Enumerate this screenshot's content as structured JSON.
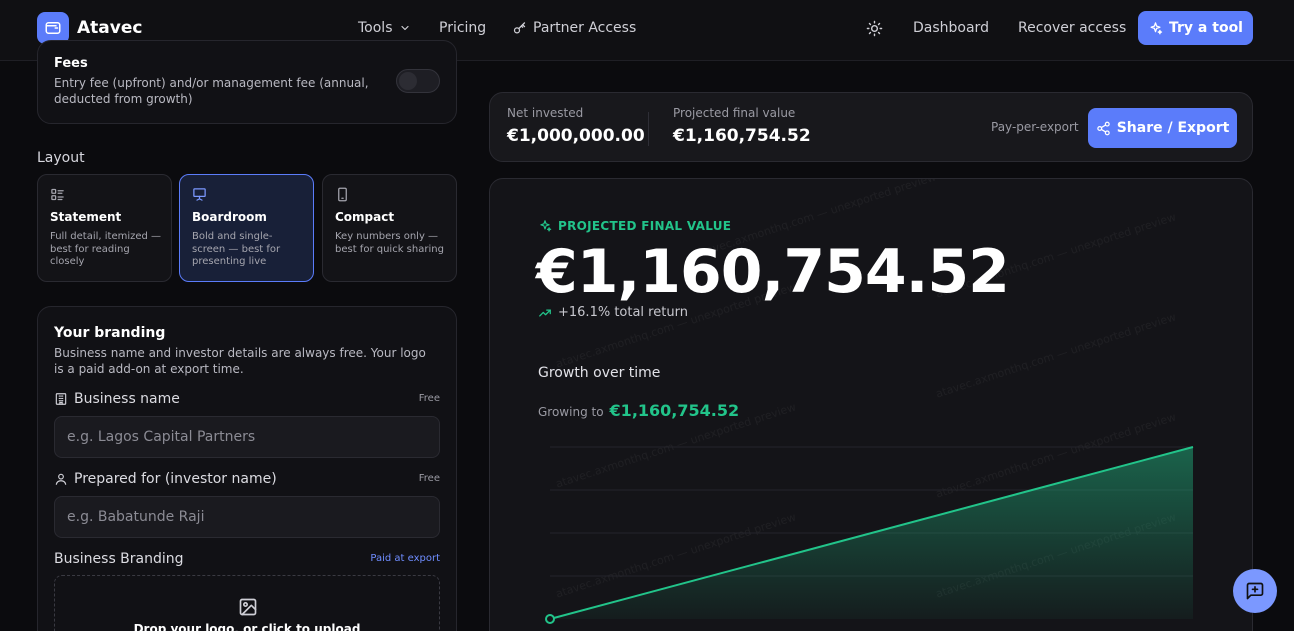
{
  "header": {
    "brand": "Atavec",
    "nav": {
      "tools": "Tools",
      "pricing": "Pricing",
      "partner_access": "Partner Access"
    },
    "dashboard": "Dashboard",
    "recover_access": "Recover access",
    "try_tool": "Try a tool"
  },
  "fees": {
    "title": "Fees",
    "description": "Entry fee (upfront) and/or management fee (annual, deducted from growth)",
    "enabled": false
  },
  "layout": {
    "label": "Layout",
    "selected": "Boardroom",
    "options": [
      {
        "title": "Statement",
        "description": "Full detail, itemized — best for reading closely",
        "icon": "list-icon"
      },
      {
        "title": "Boardroom",
        "description": "Bold and single-screen — best for presenting live",
        "icon": "presentation-icon"
      },
      {
        "title": "Compact",
        "description": "Key numbers only — best for quick sharing",
        "icon": "phone-icon"
      }
    ]
  },
  "branding": {
    "title": "Your branding",
    "description": "Business name and investor details are always free. Your logo is a paid add-on at export time.",
    "business_name": {
      "label": "Business name",
      "tag": "Free",
      "placeholder": "e.g. Lagos Capital Partners",
      "value": ""
    },
    "prepared_for": {
      "label": "Prepared for (investor name)",
      "tag": "Free",
      "placeholder": "e.g. Babatunde Raji",
      "value": ""
    },
    "business_branding": {
      "label": "Business Branding",
      "tag": "Paid at export",
      "dropzone": "Drop your logo, or click to upload"
    }
  },
  "summary": {
    "net_invested_label": "Net invested",
    "net_invested_value": "€1,000,000.00",
    "projected_label": "Projected final value",
    "projected_value": "€1,160,754.52",
    "pay_per_export": "Pay-per-export",
    "share_export": "Share / Export"
  },
  "preview": {
    "kicker": "PROJECTED FINAL VALUE",
    "big_value": "€1,160,754.52",
    "total_return": "+16.1% total return",
    "growth_title": "Growth over time",
    "growing_to_label": "Growing to",
    "growing_to_value": "€1,160,754.52",
    "watermark": "atavec.axmonthq.com — unexported preview"
  },
  "colors": {
    "accent": "#5b7cfa",
    "positive": "#22c48a",
    "background": "#0b0b0e"
  },
  "chart_data": {
    "type": "area",
    "title": "",
    "xlabel": "",
    "ylabel": "",
    "grid": true,
    "legend": "none",
    "series": [
      {
        "values": [
          1000000,
          1160754.52
        ]
      }
    ]
  }
}
